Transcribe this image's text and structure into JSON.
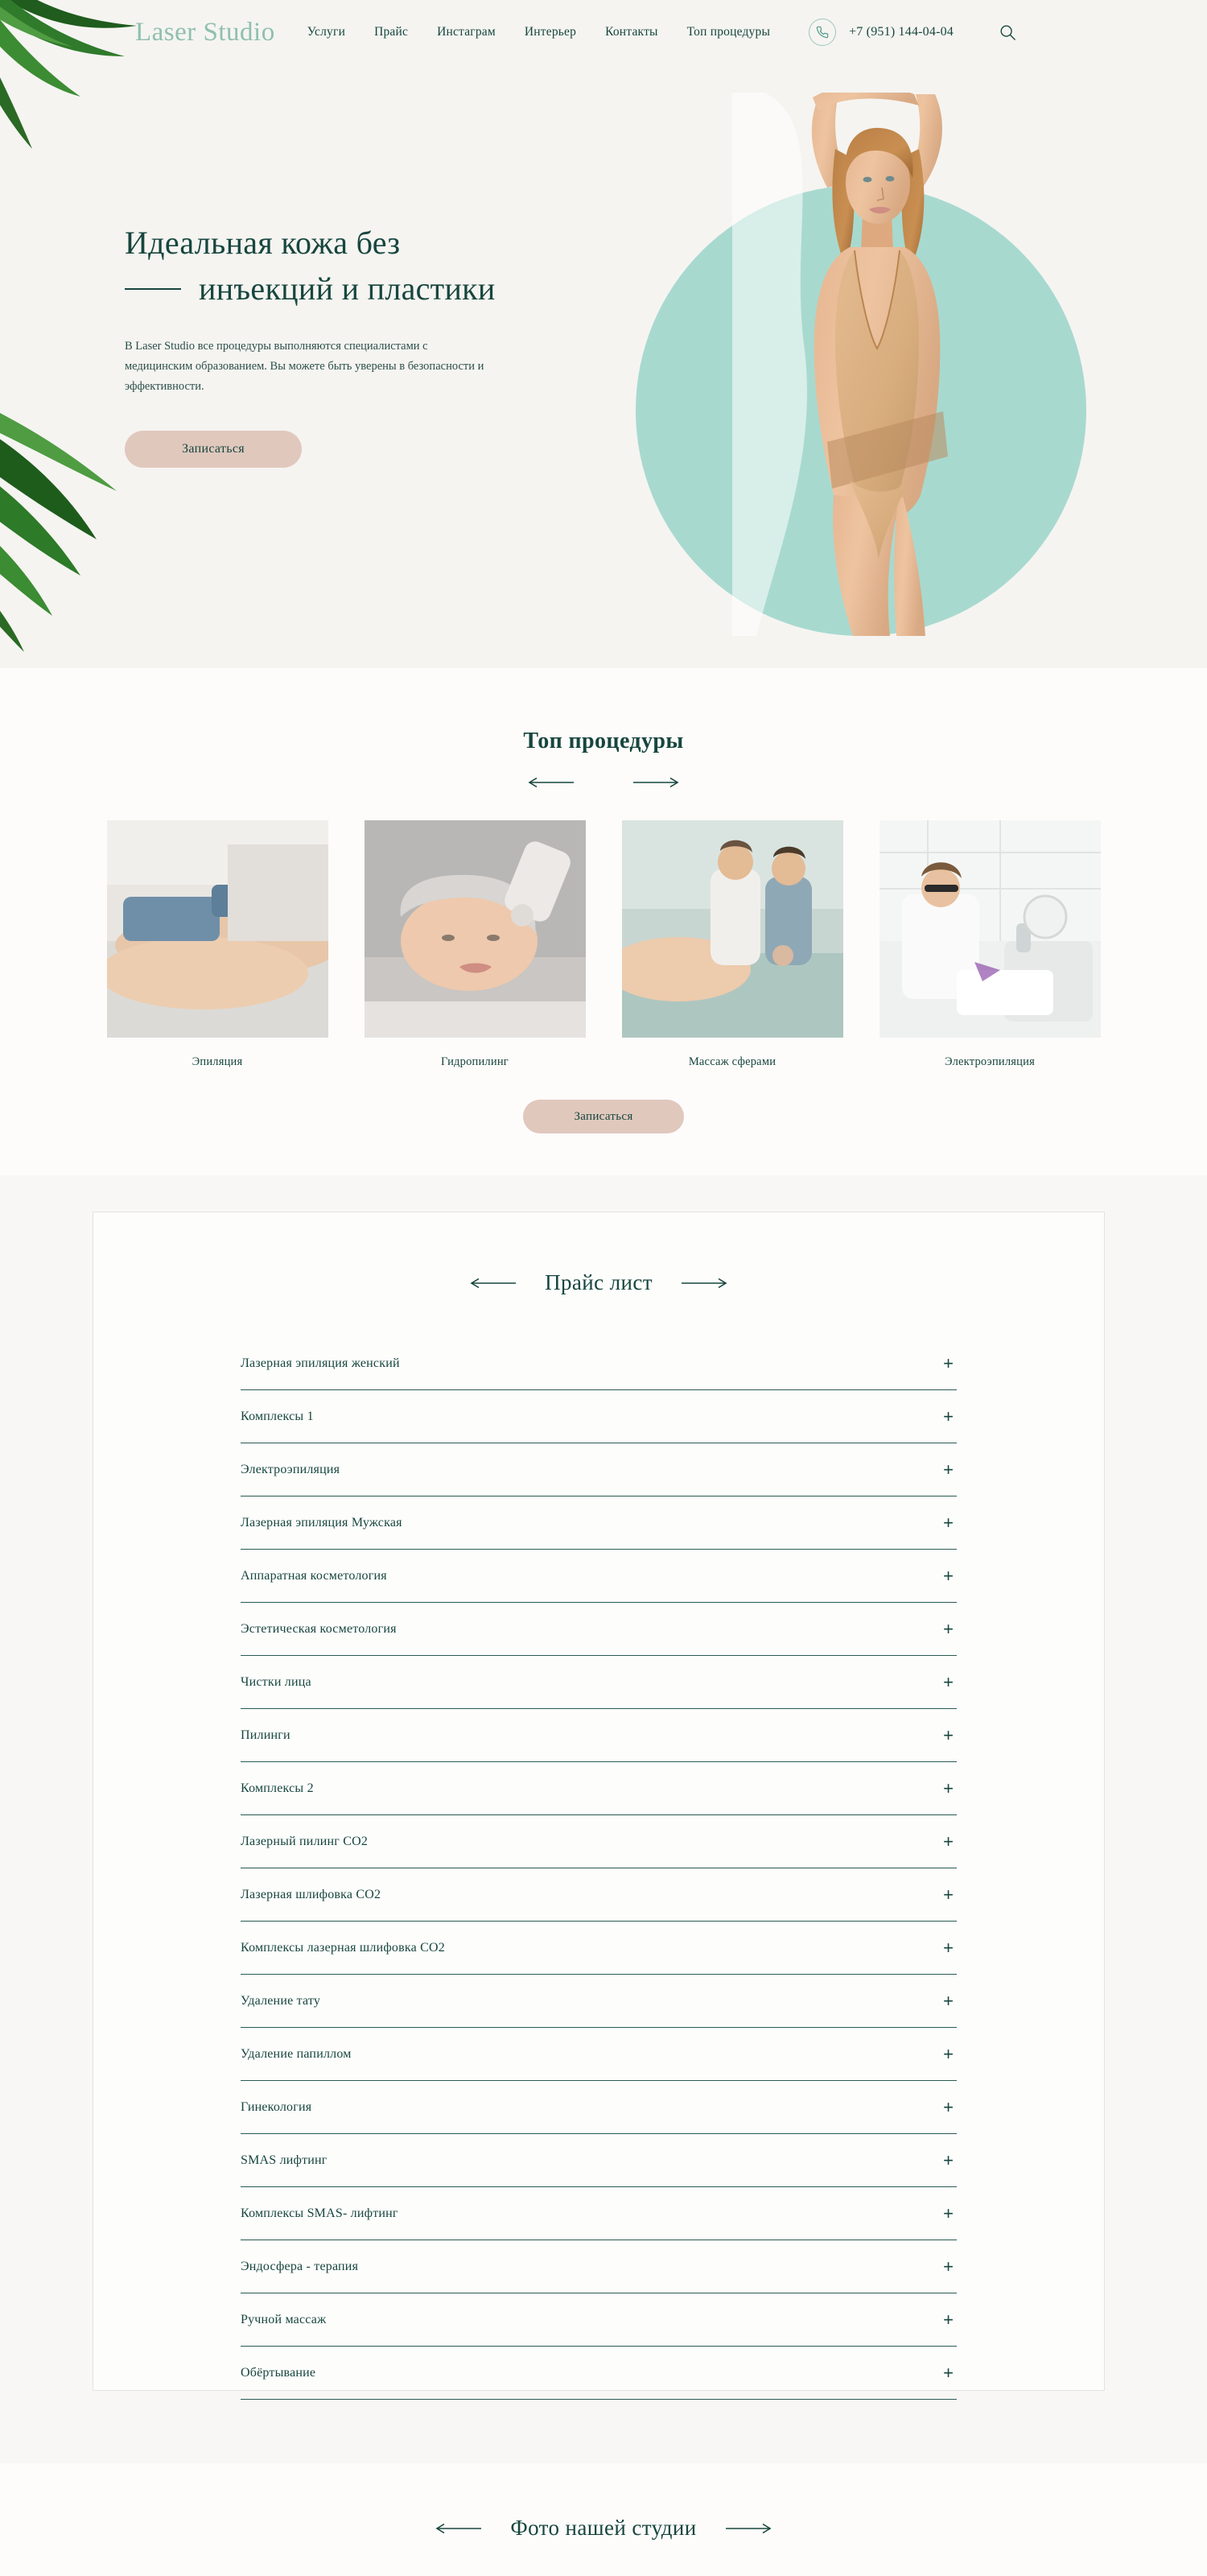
{
  "brand": {
    "logo": "Laser Studio",
    "accent_green": "#17463e",
    "accent_mint": "#a8d9cf",
    "accent_logo": "#8fbfb0",
    "accent_beige": "#e0c8bd"
  },
  "header": {
    "nav": [
      {
        "label": "Услуги"
      },
      {
        "label": "Прайс"
      },
      {
        "label": "Инстаграм"
      },
      {
        "label": "Интерьер"
      },
      {
        "label": "Контакты"
      },
      {
        "label": "Топ процедуры"
      }
    ],
    "phone": "+7 (951) 144-04-04",
    "phone_icon": "phone-icon",
    "search_icon": "search-icon"
  },
  "hero": {
    "title_line1": "Идеальная кожа без",
    "title_line2": "инъекций и пластики",
    "paragraph": "В Laser Studio все процедуры выполняются специалистами с медицинским образованием. Вы можете быть уверены в безопасности и эффективности.",
    "cta_label": "Записаться"
  },
  "top_procedures": {
    "title": "Топ процедуры",
    "prev_arrow": "arrow-left-icon",
    "next_arrow": "arrow-right-icon",
    "cards": [
      {
        "label": "Эпиляция"
      },
      {
        "label": "Гидропилинг"
      },
      {
        "label": "Массаж сферами"
      },
      {
        "label": "Электроэпиляция"
      }
    ],
    "cta_label": "Записаться"
  },
  "price_list": {
    "title": "Прайс лист",
    "expand_icon": "plus-icon",
    "items": [
      {
        "label": "Лазерная эпиляция женский"
      },
      {
        "label": "Комплексы 1"
      },
      {
        "label": "Электроэпиляция"
      },
      {
        "label": "Лазерная эпиляция Мужская"
      },
      {
        "label": "Аппаратная косметология"
      },
      {
        "label": "Эстетическая косметология"
      },
      {
        "label": "Чистки лица"
      },
      {
        "label": "Пилинги"
      },
      {
        "label": "Комплексы 2"
      },
      {
        "label": "Лазерный пилинг CO2"
      },
      {
        "label": "Лазерная шлифовка CO2"
      },
      {
        "label": "Комплексы лазерная шлифовка CO2"
      },
      {
        "label": "Удаление тату"
      },
      {
        "label": "Удаление папиллом"
      },
      {
        "label": "Гинекология"
      },
      {
        "label": "SMAS лифтинг"
      },
      {
        "label": "Комплексы  SMAS- лифтинг"
      },
      {
        "label": "Эндосфера - терапия"
      },
      {
        "label": "Ручной массаж"
      },
      {
        "label": "Обёртывание"
      }
    ]
  },
  "photos": {
    "title": "Фото нашей студии"
  }
}
